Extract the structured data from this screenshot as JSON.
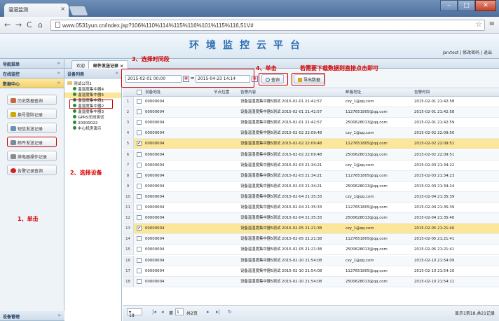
{
  "browser": {
    "tab_title": "温湿监测",
    "url": "www.0531yun.cn/index.jsp?106%110%114%115%116%101%115%116,51V#"
  },
  "app": {
    "title": "环境监控云平台",
    "user_links": "jarvtest | 修改密码 | 退出"
  },
  "left_nav": {
    "header": "导航菜单",
    "sections": [
      {
        "label": "在线监控"
      },
      {
        "label": "数据中心"
      }
    ],
    "buttons": [
      {
        "label": "历史数据查询",
        "color": "#c46a3a"
      },
      {
        "label": "换号登陆记录",
        "color": "#d2a800"
      },
      {
        "label": "短信发送记录",
        "color": "#6b8fb5"
      },
      {
        "label": "邮件发送记录",
        "color": "#7a8a9a"
      },
      {
        "label": "继电器操作记录",
        "color": "#8a8a8a"
      },
      {
        "label": "告警记录查询",
        "color": "#d21f1f"
      }
    ],
    "footer": "设备管理"
  },
  "tabs": [
    {
      "label": "欢迎"
    },
    {
      "label": "邮件发送记录"
    }
  ],
  "tree": {
    "header": "设备列表",
    "nodes": [
      {
        "label": "测试公司1",
        "type": "folder",
        "indent": 0
      },
      {
        "label": "温湿度集中器4",
        "type": "device",
        "indent": 1
      },
      {
        "label": "温湿度集中器5",
        "type": "device",
        "indent": 1,
        "selected": true
      },
      {
        "label": "温湿度集中器1",
        "type": "device",
        "indent": 1
      },
      {
        "label": "温湿度集中器2",
        "type": "device",
        "indent": 1
      },
      {
        "label": "温湿度集中器3",
        "type": "device",
        "indent": 1
      },
      {
        "label": "GPRS无线测试",
        "type": "device",
        "indent": 1
      },
      {
        "label": "20000022",
        "type": "device",
        "indent": 1
      },
      {
        "label": "中心机房演示",
        "type": "device",
        "indent": 1
      }
    ]
  },
  "toolbar": {
    "start_date": "2015-02-01 00:00",
    "end_date": "2015-04-23 14:14",
    "query_label": "查询",
    "export_label": "导出数据"
  },
  "annotations": {
    "step1": "1、单击",
    "step2": "2、选择设备",
    "step3": "3、选择时间段",
    "step4": "4、单击",
    "export_hint": "若需要下载数据则直接点击即可"
  },
  "grid": {
    "columns": [
      "设备地址",
      "节点位置",
      "告警内容",
      "邮箱地址",
      "告警时间"
    ],
    "rows": [
      {
        "num": "1",
        "checked": false,
        "addr": "00000004",
        "node": "",
        "content": "设备温湿度集中器5测试 2015-02-01 21:42:57",
        "email": "czy_1@qq.com",
        "time": "2015-02-01 21:42:58"
      },
      {
        "num": "2",
        "checked": false,
        "addr": "00000004",
        "node": "",
        "content": "设备温湿度集中器5测试 2015-02-01 21:42:57",
        "email": "1127651805@qq.com",
        "time": "2015-02-01 21:42:58"
      },
      {
        "num": "3",
        "checked": false,
        "addr": "00000004",
        "node": "",
        "content": "设备温湿度集中器5测试 2015-02-01 21:42:57",
        "email": "2500628013@qq.com",
        "time": "2015-02-01 21:42:59"
      },
      {
        "num": "4",
        "checked": false,
        "addr": "00000004",
        "node": "",
        "content": "设备温湿度集中器5测试 2015-02-02 22:09:48",
        "email": "czy_1@qq.com",
        "time": "2015-02-02 22:09:50"
      },
      {
        "num": "5",
        "checked": true,
        "addr": "00000004",
        "node": "",
        "content": "设备温湿度集中器5测试 2015-02-02 22:09:48",
        "email": "1127651805@qq.com",
        "time": "2015-02-02 22:09:51"
      },
      {
        "num": "6",
        "checked": false,
        "addr": "00000004",
        "node": "",
        "content": "设备温湿度集中器5测试 2015-02-02 22:09:48",
        "email": "2500628013@qq.com",
        "time": "2015-02-02 22:09:51"
      },
      {
        "num": "7",
        "checked": false,
        "addr": "00000004",
        "node": "",
        "content": "设备温湿度集中器5测试 2015-02-03 21:34:21",
        "email": "czy_1@qq.com",
        "time": "2015-02-03 21:34:22"
      },
      {
        "num": "8",
        "checked": false,
        "addr": "00000004",
        "node": "",
        "content": "设备温湿度集中器5测试 2015-02-03 21:34:21",
        "email": "1127651805@qq.com",
        "time": "2015-02-03 21:34:23"
      },
      {
        "num": "9",
        "checked": false,
        "addr": "00000004",
        "node": "",
        "content": "设备温湿度集中器5测试 2015-02-03 21:34:21",
        "email": "2500628013@qq.com",
        "time": "2015-02-03 21:34:24"
      },
      {
        "num": "10",
        "checked": false,
        "addr": "00000004",
        "node": "",
        "content": "设备温湿度集中器5测试 2015-02-04 21:35:33",
        "email": "czy_1@qq.com",
        "time": "2015-02-04 21:35:39"
      },
      {
        "num": "11",
        "checked": false,
        "addr": "00000004",
        "node": "",
        "content": "设备温湿度集中器5测试 2015-02-04 21:35:33",
        "email": "1127651805@qq.com",
        "time": "2015-02-04 21:35:39"
      },
      {
        "num": "12",
        "checked": false,
        "addr": "00000004",
        "node": "",
        "content": "设备温湿度集中器5测试 2015-02-04 21:35:33",
        "email": "2500628013@qq.com",
        "time": "2015-02-04 21:35:40"
      },
      {
        "num": "13",
        "checked": true,
        "addr": "00000004",
        "node": "",
        "content": "设备温湿度集中器5测试 2015-02-05 21:21:38",
        "email": "czy_1@qq.com",
        "time": "2015-02-05 21:21:40"
      },
      {
        "num": "14",
        "checked": false,
        "addr": "00000004",
        "node": "",
        "content": "设备温湿度集中器5测试 2015-02-05 21:21:38",
        "email": "1127651805@qq.com",
        "time": "2015-02-05 21:21:41"
      },
      {
        "num": "15",
        "checked": false,
        "addr": "00000004",
        "node": "",
        "content": "设备温湿度集中器5测试 2015-02-05 21:21:38",
        "email": "2500628013@qq.com",
        "time": "2015-02-05 21:21:41"
      },
      {
        "num": "16",
        "checked": false,
        "addr": "00000004",
        "node": "",
        "content": "设备温湿度集中器5测试 2015-02-10 21:54:08",
        "email": "czy_1@qq.com",
        "time": "2015-02-10 21:54:09"
      },
      {
        "num": "17",
        "checked": false,
        "addr": "00000004",
        "node": "",
        "content": "设备温湿度集中器5测试 2015-02-10 21:54:08",
        "email": "1127651805@qq.com",
        "time": "2015-02-10 21:54:10"
      },
      {
        "num": "18",
        "checked": false,
        "addr": "00000004",
        "node": "",
        "content": "设备温湿度集中器5测试 2015-02-10 21:54:08",
        "email": "2500628013@qq.com",
        "time": "2015-02-10 21:54:11"
      }
    ]
  },
  "pager": {
    "page_size": "18",
    "page_prefix": "第",
    "page": "1",
    "page_suffix": "共2页",
    "status": "显示1到18,共21记录"
  },
  "colors": {
    "accent": "#2a6db1",
    "annotation": "#d20000",
    "highlight_row": "#fbe69a"
  }
}
